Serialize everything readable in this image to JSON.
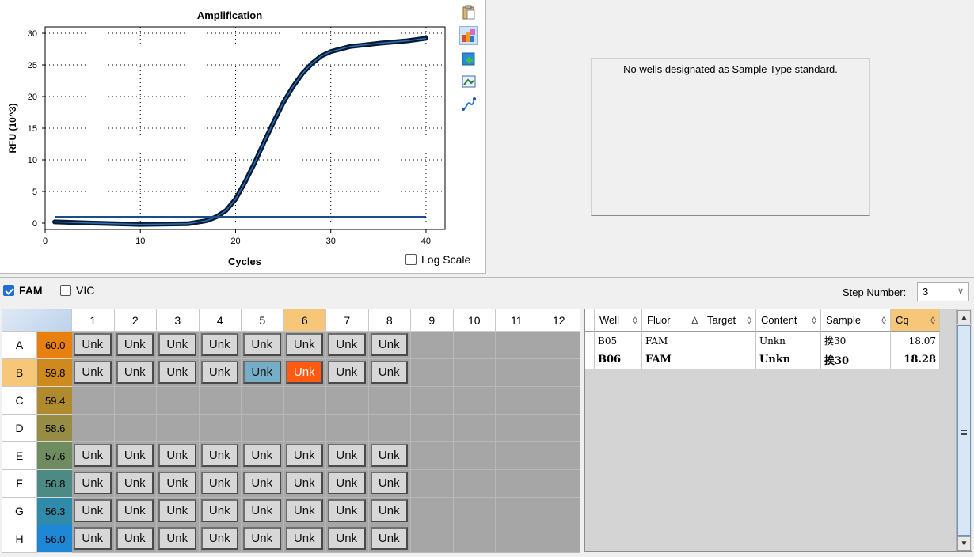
{
  "chart": {
    "title": "Amplification",
    "xlabel": "Cycles",
    "ylabel": "RFU (10^3)",
    "log_scale_label": "Log Scale",
    "log_scale_checked": false
  },
  "chart_data": {
    "type": "line",
    "title": "Amplification",
    "xlabel": "Cycles",
    "ylabel": "RFU (10^3)",
    "xlim": [
      0,
      42
    ],
    "ylim": [
      -1,
      31
    ],
    "xticks": [
      0,
      10,
      20,
      30,
      40
    ],
    "yticks": [
      0,
      5,
      10,
      15,
      20,
      25,
      30
    ],
    "grid": true,
    "series": [
      {
        "x": [
          1,
          5,
          10,
          15,
          17,
          18,
          19,
          20,
          21,
          22,
          23,
          24,
          25,
          26,
          27,
          28,
          29,
          30,
          32,
          35,
          38,
          40
        ],
        "y": [
          0.2,
          0.0,
          -0.2,
          -0.1,
          0.4,
          1.0,
          2.0,
          3.8,
          6.5,
          9.5,
          12.8,
          16.0,
          19.0,
          21.5,
          23.6,
          25.2,
          26.4,
          27.1,
          27.9,
          28.4,
          28.8,
          29.2
        ],
        "color": "#0b2d55"
      },
      {
        "x": [
          1,
          40
        ],
        "y": [
          1.0,
          1.0
        ],
        "color": "#1a4e8a"
      }
    ]
  },
  "tools": [
    "clipboard-icon",
    "chart-view-icon",
    "export-icon",
    "image-icon",
    "curve-icon"
  ],
  "standard_panel": {
    "message": "No wells designated as Sample Type standard."
  },
  "fluors": [
    {
      "label": "FAM",
      "checked": true
    },
    {
      "label": "VIC",
      "checked": false
    }
  ],
  "step": {
    "label": "Step Number:",
    "value": "3"
  },
  "plate": {
    "columns": [
      "1",
      "2",
      "3",
      "4",
      "5",
      "6",
      "7",
      "8",
      "9",
      "10",
      "11",
      "12"
    ],
    "rows": [
      "A",
      "B",
      "C",
      "D",
      "E",
      "F",
      "G",
      "H"
    ],
    "temps": [
      "60.0",
      "59.8",
      "59.4",
      "58.6",
      "57.6",
      "56.8",
      "56.3",
      "56.0"
    ],
    "temp_colors": [
      "#e8800f",
      "#cf8a1d",
      "#b08a2e",
      "#968c44",
      "#6f8c61",
      "#4d8a84",
      "#308aaa",
      "#1e88d6"
    ],
    "selected_row": "B",
    "selected_col": "6",
    "well_label": "Unk",
    "filled_rows": [
      "A",
      "B",
      "E",
      "F",
      "G",
      "H"
    ],
    "filled_cols": [
      "1",
      "2",
      "3",
      "4",
      "5",
      "6",
      "7",
      "8"
    ],
    "highlight": {
      "B5": "blue",
      "B6": "orange"
    }
  },
  "results": {
    "columns": [
      {
        "label": "Well",
        "sort": "◊"
      },
      {
        "label": "Fluor",
        "sort": "∆"
      },
      {
        "label": "Target",
        "sort": "◊"
      },
      {
        "label": "Content",
        "sort": "◊"
      },
      {
        "label": "Sample",
        "sort": "◊"
      },
      {
        "label": "Cq",
        "sort": "◊"
      }
    ],
    "rows": [
      {
        "well": "B05",
        "fluor": "FAM",
        "target": "",
        "content": "Unkn",
        "sample": "挨30",
        "cq": "18.07",
        "bold": false
      },
      {
        "well": "B06",
        "fluor": "FAM",
        "target": "",
        "content": "Unkn",
        "sample": "挨30",
        "cq": "18.28",
        "bold": true
      }
    ]
  }
}
